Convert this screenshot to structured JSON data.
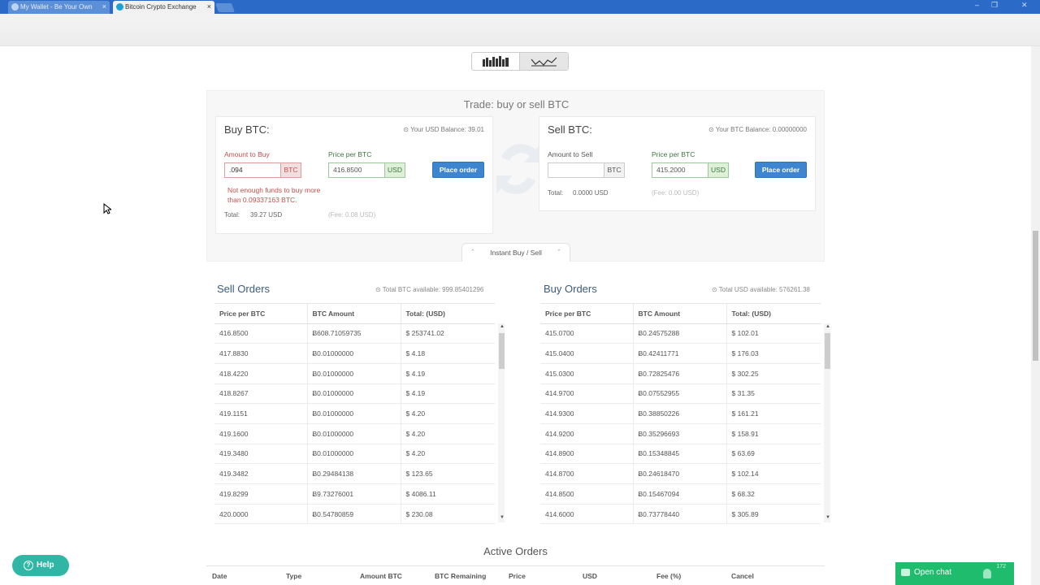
{
  "browser": {
    "tabs": [
      {
        "label": "My Wallet - Be Your Own"
      },
      {
        "label": "Bitcoin Crypto Exchange"
      }
    ],
    "tab_close": "×",
    "window_controls": [
      "–",
      "❐",
      "✕"
    ]
  },
  "trade": {
    "title": "Trade: buy or sell BTC",
    "buy": {
      "title": "Buy BTC:",
      "balance": "Your USD Balance: 39.01",
      "amount_label": "Amount to Buy",
      "amount_value": ".094",
      "amount_unit": "BTC",
      "price_label": "Price per BTC",
      "price_value": "416.8500",
      "price_unit": "USD",
      "button": "Place order",
      "error": "Not enough funds to buy more than 0.09337163 BTC.",
      "total_label": "Total:",
      "total_value": "39.27 USD",
      "fee": "(Fee: 0.08 USD)"
    },
    "sell": {
      "title": "Sell BTC:",
      "balance": "Your BTC Balance: 0.00000000",
      "amount_label": "Amount to Sell",
      "amount_value": "",
      "amount_unit": "BTC",
      "price_label": "Price per BTC",
      "price_value": "415.2000",
      "price_unit": "USD",
      "button": "Place order",
      "total_label": "Total:",
      "total_value": "0.0000 USD",
      "fee": "(Fee: 0.00 USD)"
    },
    "instant_tab": "Instant Buy / Sell"
  },
  "sell_orders": {
    "title": "Sell Orders",
    "available": "Total BTC available: 999.85401296",
    "columns": [
      "Price per BTC",
      "BTC Amount",
      "Total: (USD)"
    ],
    "rows": [
      [
        "416.8500",
        "Ƀ608.71059735",
        "$ 253741.02"
      ],
      [
        "417.8830",
        "Ƀ0.01000000",
        "$ 4.18"
      ],
      [
        "418.4220",
        "Ƀ0.01000000",
        "$ 4.19"
      ],
      [
        "418.8267",
        "Ƀ0.01000000",
        "$ 4.19"
      ],
      [
        "419.1151",
        "Ƀ0.01000000",
        "$ 4.20"
      ],
      [
        "419.1600",
        "Ƀ0.01000000",
        "$ 4.20"
      ],
      [
        "419.3480",
        "Ƀ0.01000000",
        "$ 4.20"
      ],
      [
        "419.3482",
        "Ƀ0.29484138",
        "$ 123.65"
      ],
      [
        "419.8299",
        "Ƀ9.73276001",
        "$ 4086.11"
      ],
      [
        "420.0000",
        "Ƀ0.54780859",
        "$ 230.08"
      ]
    ]
  },
  "buy_orders": {
    "title": "Buy Orders",
    "available": "Total USD available: 576261.38",
    "columns": [
      "Price per BTC",
      "BTC Amount",
      "Total: (USD)"
    ],
    "rows": [
      [
        "415.0700",
        "Ƀ0.24575288",
        "$ 102.01"
      ],
      [
        "415.0400",
        "Ƀ0.42411771",
        "$ 176.03"
      ],
      [
        "415.0300",
        "Ƀ0.72825476",
        "$ 302.25"
      ],
      [
        "414.9700",
        "Ƀ0.07552955",
        "$ 31.35"
      ],
      [
        "414.9300",
        "Ƀ0.38850226",
        "$ 161.21"
      ],
      [
        "414.9200",
        "Ƀ0.35296693",
        "$ 158.91"
      ],
      [
        "414.8900",
        "Ƀ0.15348845",
        "$ 63.69"
      ],
      [
        "414.8700",
        "Ƀ0.24618470",
        "$ 102.14"
      ],
      [
        "414.8500",
        "Ƀ0.15467094",
        "$ 68.32"
      ],
      [
        "414.6000",
        "Ƀ0.73778440",
        "$ 305.89"
      ]
    ]
  },
  "active_orders": {
    "title": "Active Orders",
    "columns": [
      "Date",
      "Type",
      "Amount BTC",
      "BTC Remaining",
      "Price",
      "USD",
      "Fee (%)",
      "Cancel"
    ]
  },
  "help": {
    "label": "Help",
    "icon": "question-icon"
  },
  "chat": {
    "label": "Open chat",
    "count": "172"
  }
}
